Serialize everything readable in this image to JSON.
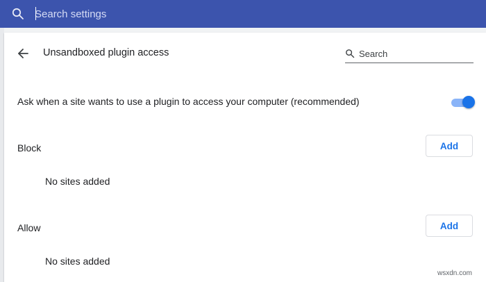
{
  "topbar": {
    "search_placeholder": "Search settings",
    "icon": "search-icon"
  },
  "subpage": {
    "title": "Unsandboxed plugin access",
    "back_icon": "arrow-back-icon",
    "search_placeholder": "Search",
    "search_icon": "search-icon"
  },
  "ask_setting": {
    "label": "Ask when a site wants to use a plugin to access your computer (recommended)",
    "enabled": true
  },
  "block": {
    "label": "Block",
    "add_label": "Add",
    "empty_text": "No sites added"
  },
  "allow": {
    "label": "Allow",
    "add_label": "Add",
    "empty_text": "No sites added"
  },
  "watermark": "wsxdn.com",
  "colors": {
    "header": "#3c54ad",
    "accent": "#1a73e8"
  }
}
